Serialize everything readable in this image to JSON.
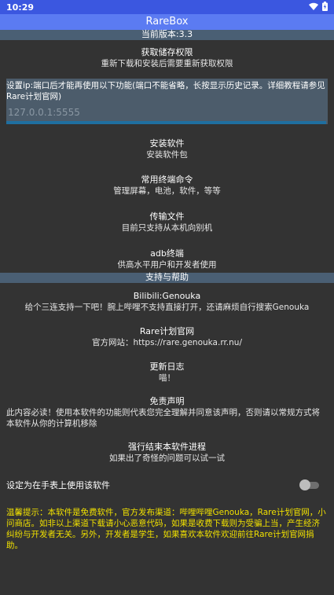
{
  "status_bar": {
    "time": "10:29",
    "wifi_icon": "wifi-icon",
    "battery_icon": "battery-charging-icon",
    "color": "#3b57e0"
  },
  "app_bar": {
    "title": "RareBox",
    "color": "#5b7bf2"
  },
  "version_bar": {
    "text": "当前版本:3.3"
  },
  "permission": {
    "title": "获取储存权限",
    "sub": "重新下载和安装后需要重新获取权限"
  },
  "ip": {
    "label": "设置ip:端口后才能再使用以下功能(端口不能省略，长按显示历史记录。详细教程请参见Rare计划官网)",
    "value": "",
    "placeholder": "127.0.0.1:5555"
  },
  "features": [
    {
      "title": "安装软件",
      "sub": "安装软件包"
    },
    {
      "title": "常用终端命令",
      "sub": "管理屏幕，电池，软件，等等"
    },
    {
      "title": "传输文件",
      "sub": "目前只支持从本机向别机"
    },
    {
      "title": "adb终端",
      "sub": "供高水平用户和开发者使用"
    }
  ],
  "support_bar": {
    "text": "支持与帮助"
  },
  "support": [
    {
      "title": "Bilibili:Genouka",
      "sub": "给个三连支持一下吧！腕上哔哩不支持直接打开，还请麻烦自行搜索Genouka"
    },
    {
      "title": "Rare计划官网",
      "sub": "官方网站：https://rare.genouka.rr.nu/"
    },
    {
      "title": "更新日志",
      "sub": "喵！"
    },
    {
      "title": "免责声明",
      "sub": "此内容必读！使用本软件的功能则代表您完全理解并同意该声明，否则请以常规方式将本软件从你的计算机移除"
    },
    {
      "title": "强行结束本软件进程",
      "sub": "如果出了奇怪的问题可以试一试"
    }
  ],
  "watch_toggle": {
    "label": "设定为在手表上使用该软件",
    "state": "off"
  },
  "notice": {
    "text": "温馨提示：本软件是免费软件，官方发布渠道：哔哩哔哩Genouka，Rare计划官网，小问商店。如非以上渠道下载请小心恶意代码，如果是收费下载则为受骗上当，产生经济纠纷与开发者无关。另外，开发者是学生，如果喜欢本软件欢迎前往Rare计划官网捐助。",
    "color": "#f0e000"
  }
}
